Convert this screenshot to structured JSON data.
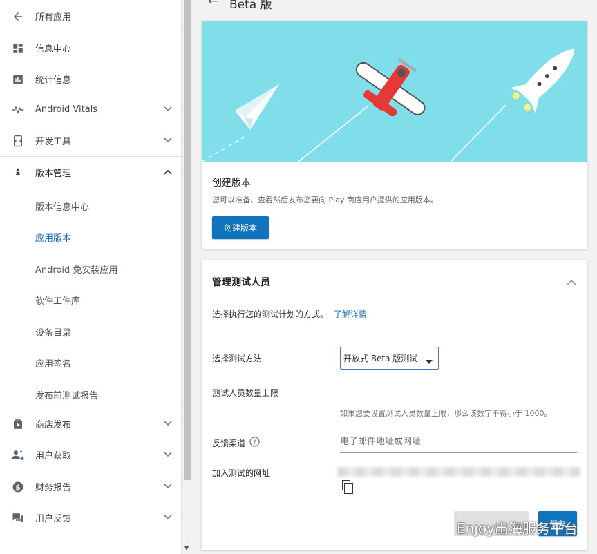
{
  "sidebar": {
    "all_apps": "所有应用",
    "items": [
      {
        "label": "信息中心",
        "icon": "dashboard-icon"
      },
      {
        "label": "统计信息",
        "icon": "bar-chart-icon"
      },
      {
        "label": "Android Vitals",
        "icon": "pulse-icon"
      },
      {
        "label": "开发工具",
        "icon": "code-icon"
      },
      {
        "label": "版本管理",
        "icon": "rocket-icon"
      },
      {
        "label": "商店发布",
        "icon": "store-icon"
      },
      {
        "label": "用户获取",
        "icon": "user-add-icon"
      },
      {
        "label": "财务报告",
        "icon": "dollar-icon"
      },
      {
        "label": "用户反馈",
        "icon": "feedback-icon"
      }
    ],
    "release_sub": [
      "版本信息中心",
      "应用版本",
      "Android 免安装应用",
      "软件工件库",
      "设备目录",
      "应用签名",
      "发布前测试报告"
    ]
  },
  "header": {
    "title": "Beta 版"
  },
  "create_card": {
    "title": "创建版本",
    "description": "您可以准备、查看然后发布您要向 Play 商店用户提供的应用版本。",
    "button": "创建版本"
  },
  "testers_card": {
    "title": "管理测试人员",
    "intro": "选择执行您的测试计划的方式。",
    "learn_more": "了解详情",
    "method_label": "选择测试方法",
    "method_value": "开放式 Beta 版测试",
    "limit_label": "测试人员数量上限",
    "limit_hint": "如果您要设置测试人员数量上限，那么该数字不得小于 1000。",
    "feedback_label": "反馈渠道",
    "feedback_placeholder": "电子邮件地址或网址",
    "join_url_label": "加入测试的网址",
    "save_button": "保存"
  },
  "watermark": "Enjoy出海服务平台",
  "colors": {
    "accent": "#0f73bd",
    "hero_bg": "#80deea",
    "link": "#0f6ab4"
  }
}
